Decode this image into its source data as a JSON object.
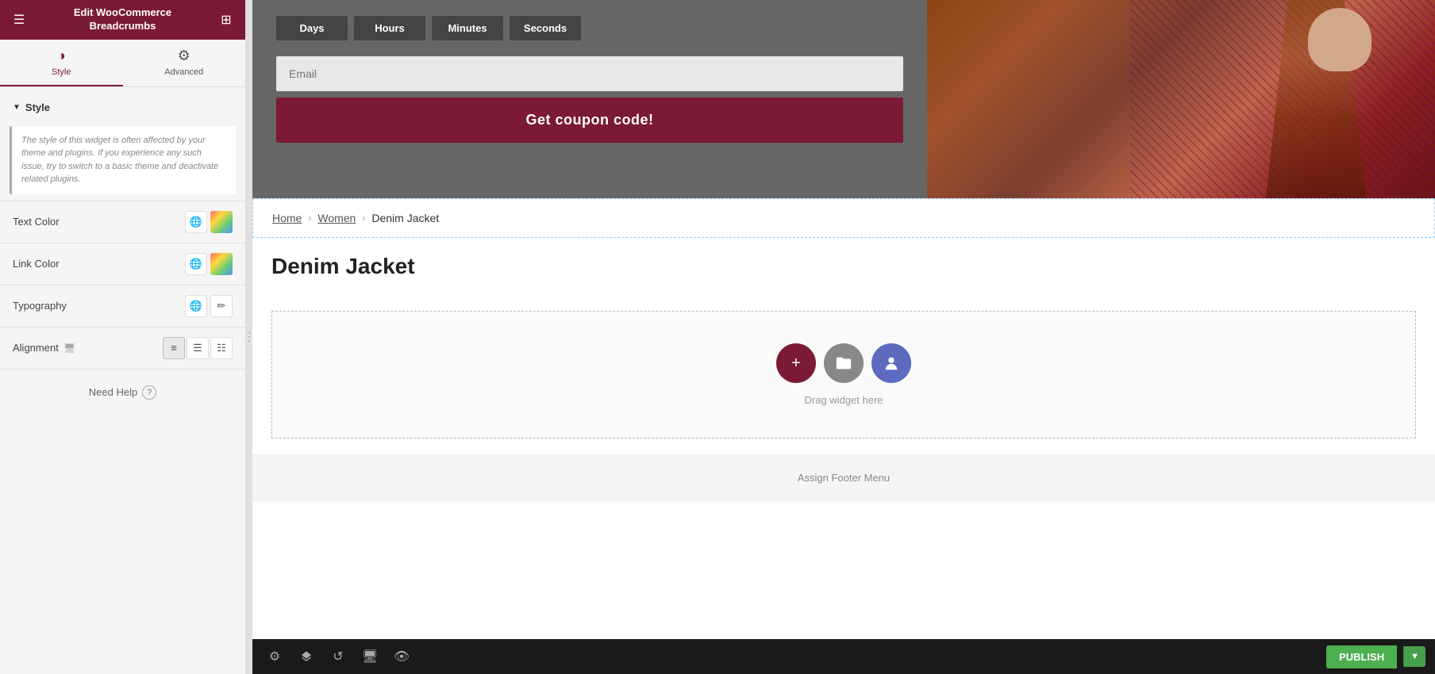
{
  "header": {
    "title": "Edit WooCommerce\nBreadcrumbs",
    "hamburger_icon": "☰",
    "grid_icon": "⊞"
  },
  "tabs": {
    "style": {
      "label": "Style",
      "icon": "◑"
    },
    "advanced": {
      "label": "Advanced",
      "icon": "⚙"
    }
  },
  "style_section": {
    "label": "Style",
    "info_text": "The style of this widget is often affected by your theme and plugins. If you experience any such issue, try to switch to a basic theme and deactivate related plugins.",
    "controls": [
      {
        "label": "Text Color",
        "id": "text-color"
      },
      {
        "label": "Link Color",
        "id": "link-color"
      },
      {
        "label": "Typography",
        "id": "typography"
      },
      {
        "label": "Alignment",
        "id": "alignment"
      }
    ]
  },
  "need_help": "Need Help",
  "toolbar": {
    "publish_label": "PUBLISH",
    "icons": [
      "gear",
      "layers",
      "history",
      "monitor",
      "eye"
    ]
  },
  "breadcrumb": {
    "items": [
      "Home",
      "Women",
      "Denim Jacket"
    ],
    "separator": "›"
  },
  "product": {
    "title": "Denim Jacket"
  },
  "promo": {
    "countdown_labels": [
      "Days",
      "Hours",
      "Minutes",
      "Seconds"
    ],
    "email_placeholder": "Email",
    "button_text": "Get coupon code!"
  },
  "drag_hint": "Drag widget here",
  "footer": {
    "text": "Assign Footer Menu"
  },
  "colors": {
    "brand": "#7b1a34",
    "accent_blue": "#5c6bc0",
    "toolbar_bg": "#1a1a1a",
    "publish_green": "#4caf50"
  }
}
